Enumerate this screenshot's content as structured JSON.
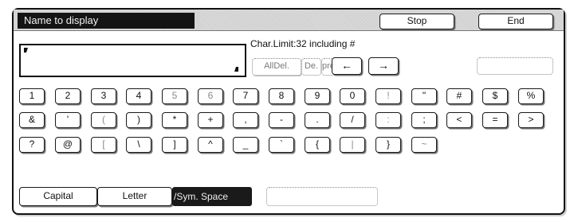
{
  "header": {
    "title": "Name to display",
    "stop_label": "Stop",
    "end_label": "End"
  },
  "entry": {
    "value": ""
  },
  "char_limit": "Char.Limit:32 including #",
  "edit": {
    "alldel_label": "AllDel.",
    "del_label": "De.",
    "prev_label": "prev.",
    "left_arrow": "←",
    "right_arrow": "→"
  },
  "keys": {
    "row1": [
      "1",
      "2",
      "3",
      "4",
      "5",
      "6",
      "7",
      "8",
      "9",
      "0",
      "!",
      "\"",
      "#",
      "$",
      "%"
    ],
    "row2": [
      "&",
      "'",
      "(",
      ")",
      "*",
      "+",
      ",",
      "-",
      ".",
      "/",
      ":",
      ";",
      "<",
      "=",
      ">"
    ],
    "row3": [
      "?",
      "@",
      "[",
      "\\",
      "]",
      "^",
      "_",
      "`",
      "{",
      "|",
      "}",
      "~"
    ]
  },
  "mode": {
    "capital_label": "Capital",
    "letter_label": "Letter",
    "sym_label": "/Sym. Space"
  }
}
